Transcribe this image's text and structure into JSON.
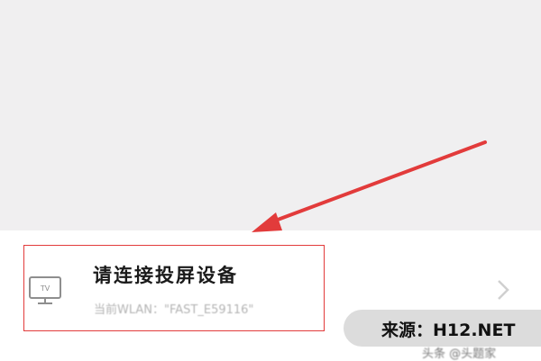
{
  "cast_item": {
    "title": "请连接投屏设备",
    "subtitle": "当前WLAN：\"FAST_E59116\"",
    "icon": "tv-icon",
    "icon_label": "TV",
    "chevron": "chevron-right-icon"
  },
  "annotation": {
    "arrow_color": "#e23b3b",
    "box_color": "#e23b3b"
  },
  "watermark": {
    "text": "来源：H12.NET"
  },
  "faded_text": "头条 @头题家",
  "colors": {
    "top_background": "#f0eff0",
    "bottom_background": "#ffffff",
    "title": "#1a1a1a",
    "subtitle": "#b4b4b4",
    "annotation": "#e23b3b"
  }
}
